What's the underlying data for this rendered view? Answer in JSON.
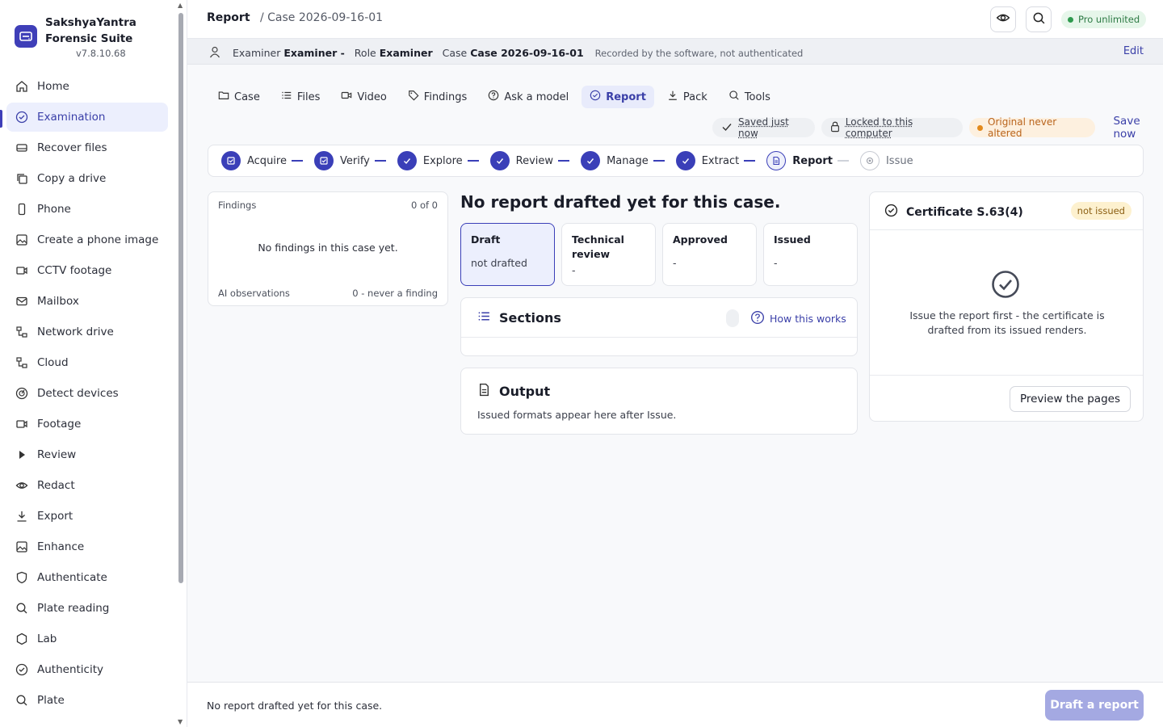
{
  "app": {
    "name_line1": "SakshyaYantra",
    "name_line2": "Forensic Suite",
    "version": "v7.8.10.68"
  },
  "sidebar": {
    "items": [
      {
        "label": "Home",
        "icon": "home-icon"
      },
      {
        "label": "Examination",
        "icon": "check-circle-icon",
        "active": true
      },
      {
        "label": "Recover files",
        "icon": "drive-icon"
      },
      {
        "label": "Copy a drive",
        "icon": "copy-icon"
      },
      {
        "label": "Phone",
        "icon": "phone-icon"
      },
      {
        "label": "Create a phone image",
        "icon": "image-icon"
      },
      {
        "label": "CCTV footage",
        "icon": "camera-icon"
      },
      {
        "label": "Mailbox",
        "icon": "mail-icon"
      },
      {
        "label": "Network drive",
        "icon": "network-icon"
      },
      {
        "label": "Cloud",
        "icon": "network-icon"
      },
      {
        "label": "Detect devices",
        "icon": "detect-icon"
      },
      {
        "label": "Footage",
        "icon": "camera-icon"
      },
      {
        "label": "Review",
        "icon": "play-icon"
      },
      {
        "label": "Redact",
        "icon": "eye-icon"
      },
      {
        "label": "Export",
        "icon": "download-icon"
      },
      {
        "label": "Enhance",
        "icon": "image-icon"
      },
      {
        "label": "Authenticate",
        "icon": "shield-icon"
      },
      {
        "label": "Plate reading",
        "icon": "search-icon"
      },
      {
        "label": "Lab",
        "icon": "lab-icon"
      },
      {
        "label": "Authenticity",
        "icon": "check-circle-icon"
      },
      {
        "label": "Plate",
        "icon": "search-icon"
      }
    ]
  },
  "header": {
    "breadcrumb_current": "Report",
    "breadcrumb_case": "/ Case 2026-09-16-01",
    "pro_badge": "Pro unlimited"
  },
  "examiner_bar": {
    "examiner_label": "Examiner",
    "examiner_value": "Examiner -",
    "role_label": "Role",
    "role_value": "Examiner",
    "case_label": "Case",
    "case_value": "Case 2026-09-16-01",
    "note": "Recorded by the software, not authenticated",
    "edit_label": "Edit"
  },
  "tabs": [
    {
      "label": "Case",
      "icon": "folder-icon"
    },
    {
      "label": "Files",
      "icon": "list-icon"
    },
    {
      "label": "Video",
      "icon": "video-icon"
    },
    {
      "label": "Findings",
      "icon": "tag-icon"
    },
    {
      "label": "Ask a model",
      "icon": "help-icon"
    },
    {
      "label": "Report",
      "icon": "check-circle-icon",
      "active": true
    },
    {
      "label": "Pack",
      "icon": "download-icon"
    },
    {
      "label": "Tools",
      "icon": "search-icon"
    }
  ],
  "status": {
    "saved": "Saved just now",
    "locked": "Locked to this computer",
    "original": "Original never altered",
    "save_now": "Save now"
  },
  "stepper": [
    {
      "label": "Acquire",
      "state": "done"
    },
    {
      "label": "Verify",
      "state": "done"
    },
    {
      "label": "Explore",
      "state": "done"
    },
    {
      "label": "Review",
      "state": "done"
    },
    {
      "label": "Manage",
      "state": "done"
    },
    {
      "label": "Extract",
      "state": "done"
    },
    {
      "label": "Report",
      "state": "current"
    },
    {
      "label": "Issue",
      "state": "todo"
    }
  ],
  "findings": {
    "title": "Findings",
    "count": "0 of 0",
    "empty": "No findings in this case yet.",
    "ai_label": "AI observations",
    "ai_value": "0 - never a finding"
  },
  "report": {
    "heading": "No report drafted yet for this case.",
    "states": [
      {
        "title": "Draft",
        "value": "not drafted"
      },
      {
        "title": "Technical review",
        "value": "-"
      },
      {
        "title": "Approved",
        "value": "-"
      },
      {
        "title": "Issued",
        "value": "-"
      }
    ],
    "sections_title": "Sections",
    "how_link": "How this works",
    "output_title": "Output",
    "output_sub": "Issued formats appear here after Issue."
  },
  "certificate": {
    "title": "Certificate S.63(4)",
    "badge": "not issued",
    "message": "Issue the report first - the certificate is drafted from its issued renders.",
    "preview_button": "Preview the pages"
  },
  "footer": {
    "message": "No report drafted yet for this case.",
    "draft_button": "Draft a report"
  },
  "colors": {
    "accent": "#3a3fb8",
    "pro_green": "#2e9a4e",
    "warning_orange": "#e38a1c",
    "disabled_primary": "#a4a9e2"
  }
}
